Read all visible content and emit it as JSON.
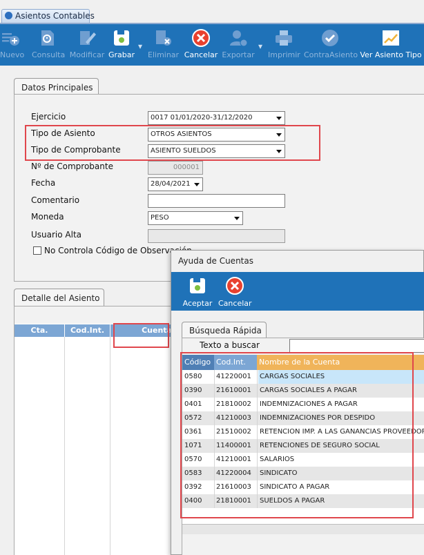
{
  "window_tab": {
    "label": "Asientos Contables"
  },
  "toolbar": {
    "nuevo": "Nuevo",
    "consulta": "Consulta",
    "modificar": "Modificar",
    "grabar": "Grabar",
    "eliminar": "Eliminar",
    "cancelar": "Cancelar",
    "exportar": "Exportar",
    "imprimir": "Imprimir",
    "contra_asiento": "ContraAsiento",
    "ver_asiento_tipo": "Ver Asiento Tipo"
  },
  "datos_principales": {
    "tab_label": "Datos Principales",
    "ejercicio_label": "Ejercicio",
    "ejercicio_value": "0017 01/01/2020-31/12/2020",
    "tipo_asiento_label": "Tipo de Asiento",
    "tipo_asiento_value": "OTROS ASIENTOS",
    "tipo_comprobante_label": "Tipo de Comprobante",
    "tipo_comprobante_value": "ASIENTO SUELDOS",
    "nro_comprobante_label": "Nº de Comprobante",
    "nro_comprobante_value": "000001",
    "fecha_label": "Fecha",
    "fecha_value": "28/04/2021",
    "comentario_label": "Comentario",
    "comentario_value": "",
    "moneda_label": "Moneda",
    "moneda_value": "PESO",
    "usuario_alta_label": "Usuario Alta",
    "usuario_alta_value": "",
    "no_controla_label": "No Controla Código de Observación"
  },
  "detalle": {
    "tab_label": "Detalle del Asiento",
    "columns": [
      "Cta.",
      "Cod.Int.",
      "Cuenta"
    ]
  },
  "ayuda_cuentas": {
    "title": "Ayuda de Cuentas",
    "aceptar": "Aceptar",
    "cancelar": "Cancelar",
    "busqueda_tab": "Búsqueda Rápida",
    "texto_buscar_label": "Texto a buscar",
    "texto_buscar_value": "",
    "columns": {
      "codigo": "Código",
      "cod_int": "Cod.Int.",
      "nombre": "Nombre de la Cuenta"
    },
    "rows": [
      {
        "codigo": "0580",
        "cod_int": "41220001",
        "nombre": "CARGAS SOCIALES"
      },
      {
        "codigo": "0390",
        "cod_int": "21610001",
        "nombre": "CARGAS SOCIALES A PAGAR"
      },
      {
        "codigo": "0401",
        "cod_int": "21810002",
        "nombre": "INDEMNIZACIONES A PAGAR"
      },
      {
        "codigo": "0572",
        "cod_int": "41210003",
        "nombre": "INDEMNIZACIONES POR DESPIDO"
      },
      {
        "codigo": "0361",
        "cod_int": "21510002",
        "nombre": "RETENCION IMP. A LAS GANANCIAS PROVEEDOR"
      },
      {
        "codigo": "1071",
        "cod_int": "11400001",
        "nombre": "RETENCIONES DE SEGURO SOCIAL"
      },
      {
        "codigo": "0570",
        "cod_int": "41210001",
        "nombre": "SALARIOS"
      },
      {
        "codigo": "0583",
        "cod_int": "41220004",
        "nombre": "SINDICATO"
      },
      {
        "codigo": "0392",
        "cod_int": "21610003",
        "nombre": "SINDICATO A PAGAR"
      },
      {
        "codigo": "0400",
        "cod_int": "21810001",
        "nombre": "SUELDOS A PAGAR"
      }
    ]
  },
  "colors": {
    "toolbar_blue": "#1f72b8",
    "grid_header_blue": "#7ca6d4",
    "highlight_red": "#e0464c",
    "name_header_orange": "#f0b45a",
    "selected_row": "#c8e6fa"
  }
}
